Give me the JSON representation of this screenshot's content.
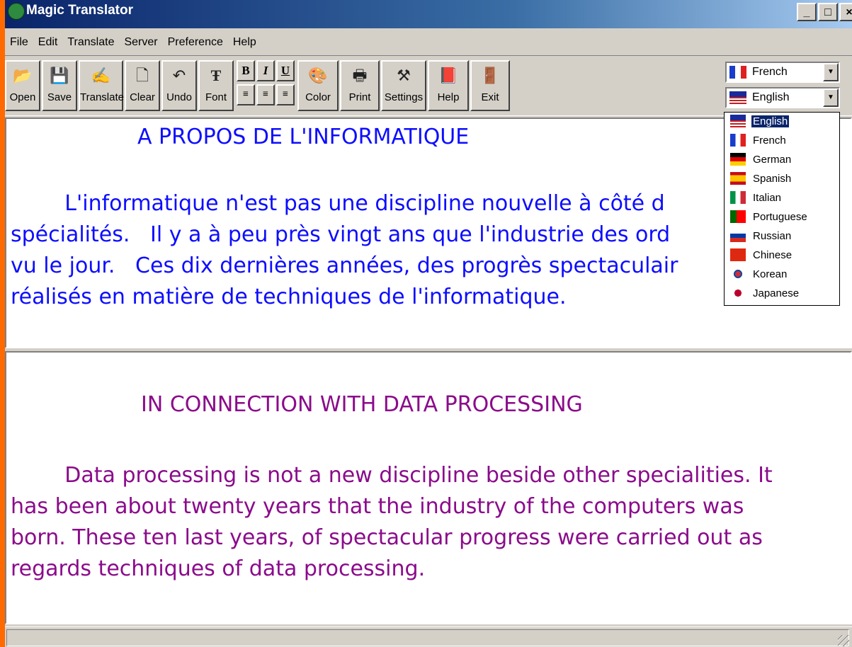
{
  "window": {
    "title": "Magic Translator",
    "controls": [
      "_",
      "□",
      "×"
    ]
  },
  "menubar": [
    "File",
    "Edit",
    "Translate",
    "Server",
    "Preference",
    "Help"
  ],
  "toolbar": {
    "open": "Open",
    "save": "Save",
    "translate": "Translate",
    "clear": "Clear",
    "undo": "Undo",
    "font": "Font",
    "bold": "B",
    "italic": "I",
    "underline": "U",
    "color": "Color",
    "print": "Print",
    "settings": "Settings",
    "help": "Help",
    "exit": "Exit"
  },
  "language": {
    "source": "French",
    "target": "English"
  },
  "dropdown_items": [
    "English",
    "French",
    "German",
    "Spanish",
    "Italian",
    "Portuguese",
    "Russian",
    "Chinese",
    "Korean",
    "Japanese"
  ],
  "source_text": {
    "heading": "A PROPOS DE L'INFORMATIQUE",
    "lines": [
      "        L'informatique n'est pas une discipline nouvelle à côté d",
      "spécialités.   Il y a à peu près vingt ans que l'industrie des ord",
      "vu le jour.   Ces dix dernières années, des progrès spectaculair",
      "réalisés en matière de techniques de l'informatique."
    ]
  },
  "target_text": {
    "heading": "IN CONNECTION WITH DATA PROCESSING",
    "lines": [
      "        Data processing is not a new discipline beside other specialities. It",
      "has been about twenty years that the industry of the computers was",
      "born. These ten last years, of spectacular progress were carried out as",
      "regards techniques of data processing."
    ]
  },
  "colors": {
    "source_text": "#0d0dff",
    "target_text": "#8b0b8b",
    "titlebar": "#0a246a",
    "desktop": "#ff6a00"
  }
}
